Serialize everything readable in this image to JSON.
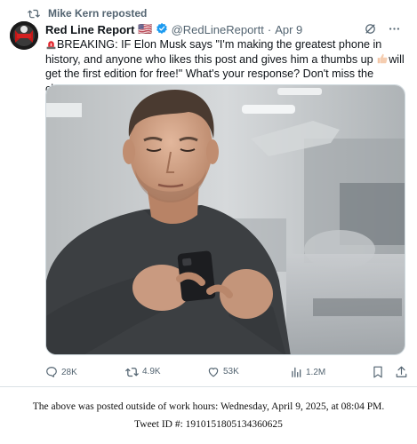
{
  "repost": {
    "icon": "repost-icon",
    "label": "Mike Kern reposted"
  },
  "tweet": {
    "display_name": "Red Line Report",
    "flag": "🇺🇸",
    "handle": "@RedLineReportt",
    "separator": "·",
    "date": "Apr 9",
    "icons": [
      "verified-badge-icon",
      "grok-icon",
      "more-icon",
      "siren-emoji",
      "thumbs-up-emoji"
    ],
    "text_part1": "BREAKING: IF Elon Musk says \"I'm making the greatest phone in history, and anyone who likes this post and gives him a thumbs up ",
    "text_part2": "will get the first edition for free!\" What's your response? Don't miss the chance!!",
    "accent_color": "#1d9bf0"
  },
  "actions": {
    "replies": "28K",
    "reposts": "4.9K",
    "likes": "53K",
    "views": "1.2M"
  },
  "footer": {
    "line1": "The above was posted outside of work hours: Wednesday, April 9, 2025, at 08:04 PM.",
    "line2": "Tweet ID #: 1910151805134360625"
  }
}
